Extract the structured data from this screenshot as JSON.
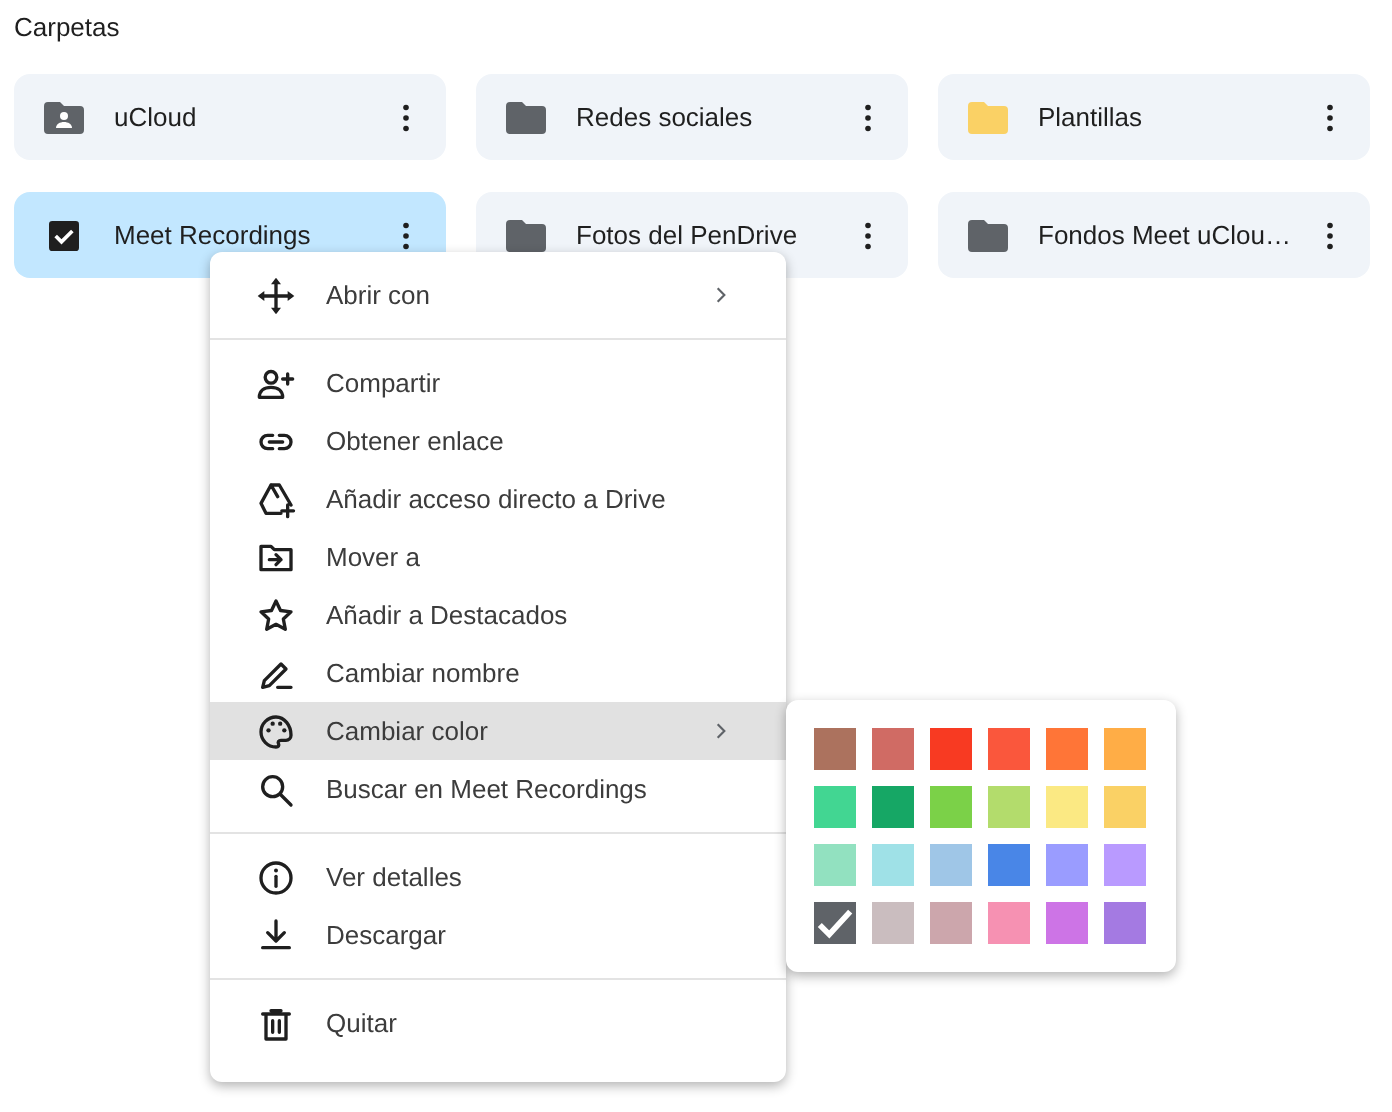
{
  "section_title": "Carpetas",
  "folders": [
    {
      "name": "uCloud",
      "kind": "shared",
      "color": "#5f6368",
      "selected": false
    },
    {
      "name": "Redes sociales",
      "kind": "plain",
      "color": "#5f6368",
      "selected": false
    },
    {
      "name": "Plantillas",
      "kind": "plain",
      "color": "#fad165",
      "selected": false
    },
    {
      "name": "Meet Recordings",
      "selected": true
    },
    {
      "name": "Fotos del PenDrive",
      "kind": "plain",
      "color": "#5f6368",
      "selected": false
    },
    {
      "name": "Fondos Meet uClou…",
      "kind": "plain",
      "color": "#5f6368",
      "selected": false
    }
  ],
  "context_menu": [
    [
      {
        "label": "Abrir con",
        "submenu": true,
        "highlighted": false
      }
    ],
    [
      {
        "label": "Compartir",
        "submenu": false,
        "highlighted": false
      },
      {
        "label": "Obtener enlace",
        "submenu": false,
        "highlighted": false
      },
      {
        "label": "Añadir acceso directo a Drive",
        "submenu": false,
        "highlighted": false
      },
      {
        "label": "Mover a",
        "submenu": false,
        "highlighted": false
      },
      {
        "label": "Añadir a Destacados",
        "submenu": false,
        "highlighted": false
      },
      {
        "label": "Cambiar nombre",
        "submenu": false,
        "highlighted": false
      },
      {
        "label": "Cambiar color",
        "submenu": true,
        "highlighted": true
      },
      {
        "label": "Buscar en Meet Recordings",
        "submenu": false,
        "highlighted": false
      }
    ],
    [
      {
        "label": "Ver detalles",
        "submenu": false,
        "highlighted": false
      },
      {
        "label": "Descargar",
        "submenu": false,
        "highlighted": false
      }
    ],
    [
      {
        "label": "Quitar",
        "submenu": false,
        "highlighted": false
      }
    ]
  ],
  "color_palette": [
    {
      "color": "#ac725e",
      "selected": false
    },
    {
      "color": "#d06b64",
      "selected": false
    },
    {
      "color": "#f83a22",
      "selected": false
    },
    {
      "color": "#fa573c",
      "selected": false
    },
    {
      "color": "#ff7537",
      "selected": false
    },
    {
      "color": "#ffad46",
      "selected": false
    },
    {
      "color": "#42d692",
      "selected": false
    },
    {
      "color": "#16a765",
      "selected": false
    },
    {
      "color": "#7bd148",
      "selected": false
    },
    {
      "color": "#b3dc6c",
      "selected": false
    },
    {
      "color": "#fbe983",
      "selected": false
    },
    {
      "color": "#fad165",
      "selected": false
    },
    {
      "color": "#92e1c0",
      "selected": false
    },
    {
      "color": "#9fe1e7",
      "selected": false
    },
    {
      "color": "#9fc6e7",
      "selected": false
    },
    {
      "color": "#4986e7",
      "selected": false
    },
    {
      "color": "#9a9cff",
      "selected": false
    },
    {
      "color": "#b99aff",
      "selected": false
    },
    {
      "color": "#5f6368",
      "selected": true
    },
    {
      "color": "#cabdbf",
      "selected": false
    },
    {
      "color": "#cca6ac",
      "selected": false
    },
    {
      "color": "#f691b2",
      "selected": false
    },
    {
      "color": "#cd74e6",
      "selected": false
    },
    {
      "color": "#a47ae2",
      "selected": false
    }
  ]
}
